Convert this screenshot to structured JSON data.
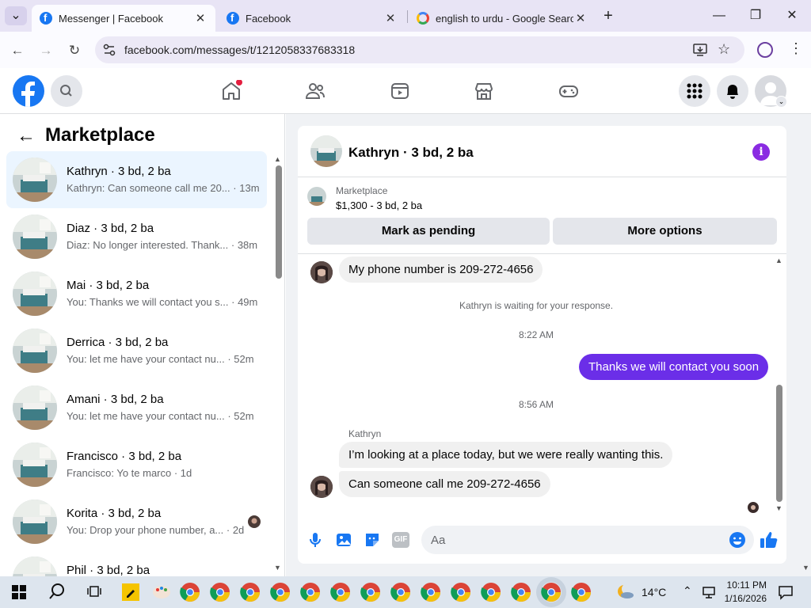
{
  "browser": {
    "tabs": [
      {
        "title": "Messenger | Facebook",
        "active": true
      },
      {
        "title": "Facebook",
        "active": false
      },
      {
        "title": "english to urdu - Google Search",
        "active": false
      }
    ],
    "url": "facebook.com/messages/t/1212058337683318"
  },
  "sidebar": {
    "title": "Marketplace",
    "conversations": [
      {
        "name": "Kathryn · 3 bd, 2 ba",
        "preview": "Kathryn: Can someone call me 20...",
        "time": "· 13m",
        "selected": true
      },
      {
        "name": "Diaz · 3 bd, 2 ba",
        "preview": "Diaz: No longer interested. Thank...",
        "time": "· 38m"
      },
      {
        "name": "Mai · 3 bd, 2 ba",
        "preview": "You: Thanks we will contact you s...",
        "time": "· 49m"
      },
      {
        "name": "Derrica · 3 bd, 2 ba",
        "preview": "You: let me have your contact nu...",
        "time": "· 52m"
      },
      {
        "name": "Amani · 3 bd, 2 ba",
        "preview": "You: let me have your contact nu...",
        "time": "· 52m"
      },
      {
        "name": "Francisco · 3 bd, 2 ba",
        "preview": "Francisco: Yo te marco",
        "time": "· 1d"
      },
      {
        "name": "Korita · 3 bd, 2 ba",
        "preview": "You: Drop your phone number, a...",
        "time": "· 2d"
      },
      {
        "name": "Phil · 3 bd, 2 ba",
        "preview": "",
        "time": ""
      }
    ]
  },
  "chat": {
    "title": "Kathryn · 3 bd, 2 ba",
    "listing_source": "Marketplace",
    "listing_price": "$1,300 - 3 bd, 2 ba",
    "mark_pending_label": "Mark as pending",
    "more_options_label": "More options",
    "messages": {
      "m1": "My phone number is 209-272-4656",
      "waiting": "Kathryn is waiting for your response.",
      "time1": "8:22 AM",
      "out1": "Thanks we will contact you soon",
      "time2": "8:56 AM",
      "sender": "Kathryn",
      "m2": "I’m looking at a place today, but we were really wanting this.",
      "m3": "Can someone call me 209-272-4656"
    },
    "composer_placeholder": "Aa"
  },
  "taskbar": {
    "weather": "14°C",
    "time": "10:11 PM",
    "date": "1/16/2026"
  },
  "colors": {
    "fb_blue": "#1877f2",
    "messenger_purple": "#6b2ee8",
    "accent_purple": "#8a2be2"
  }
}
